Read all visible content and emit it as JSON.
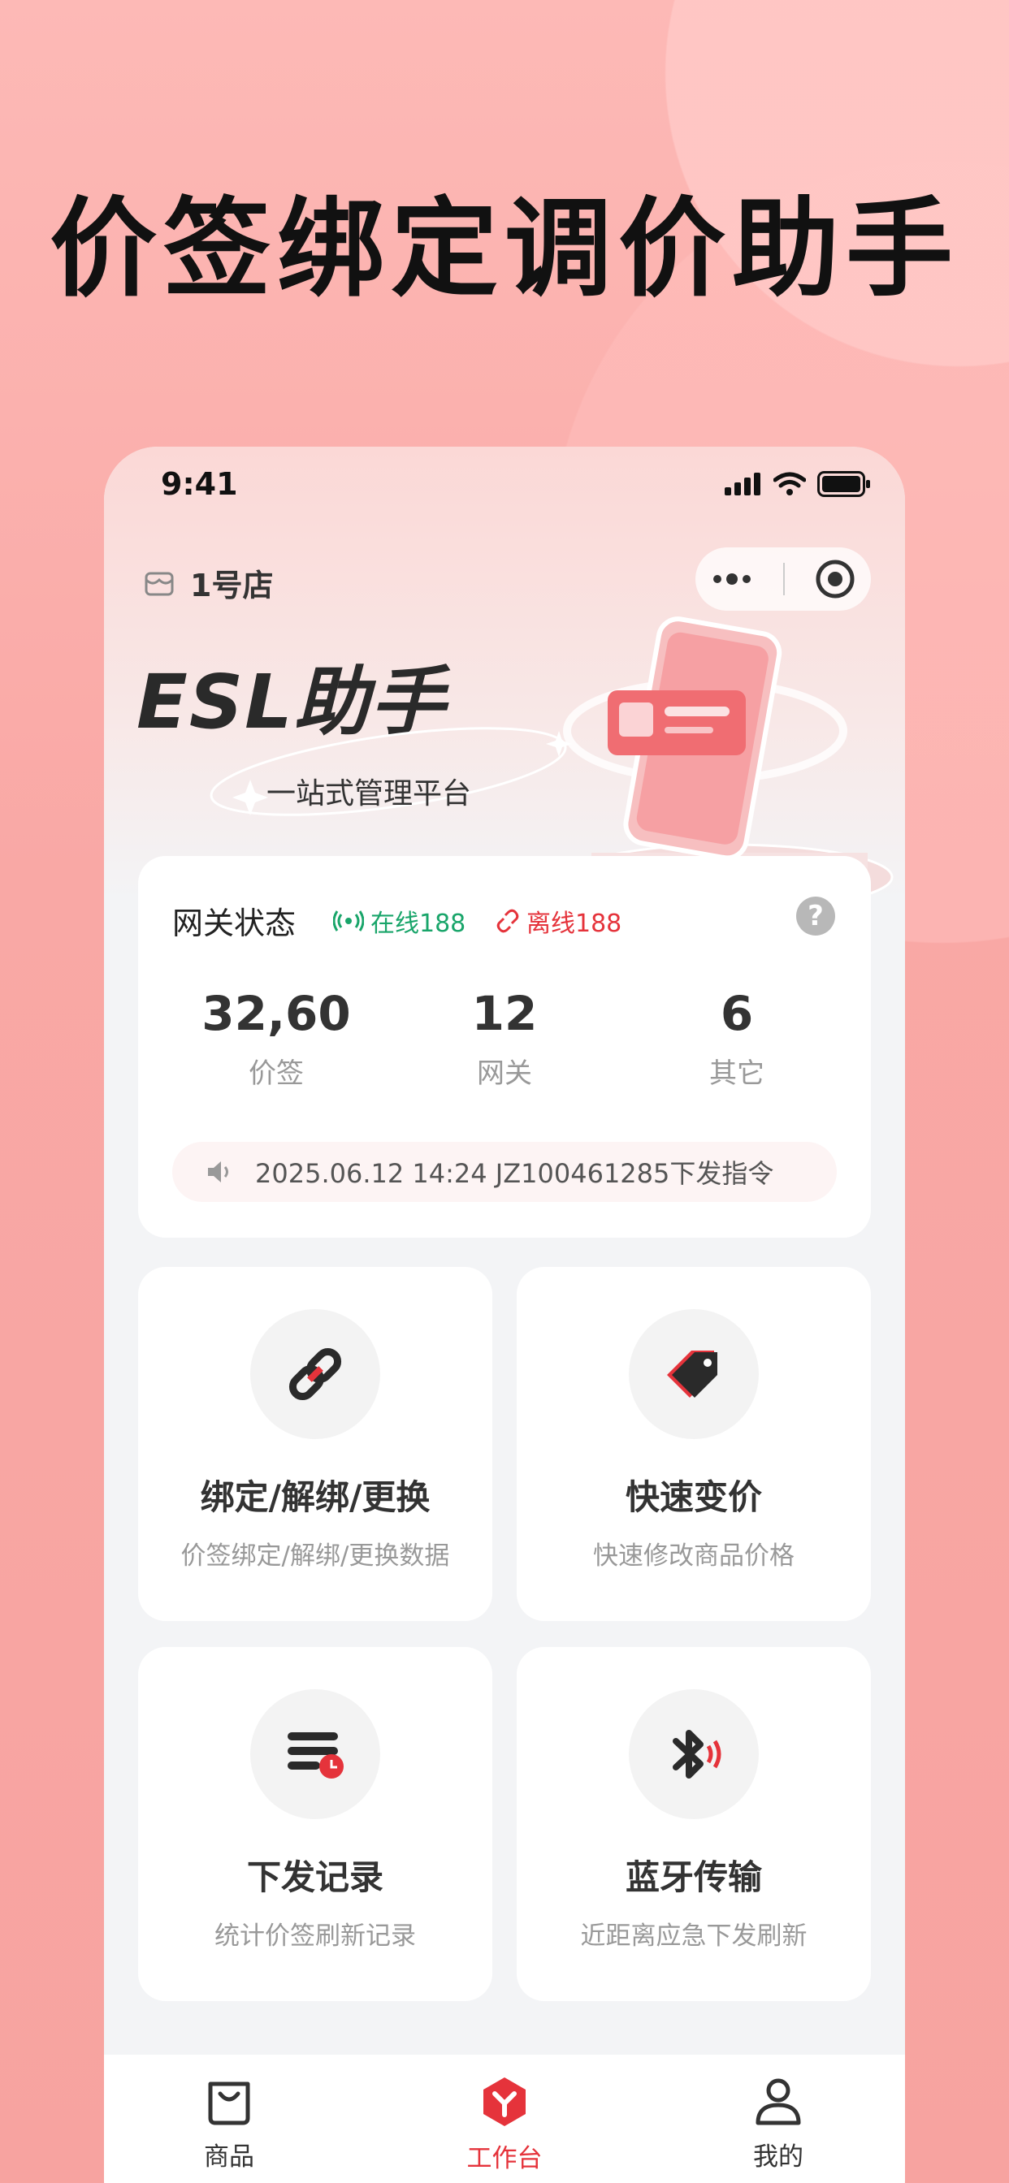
{
  "headline": "价签绑定调价助手",
  "status_bar": {
    "time": "9:41"
  },
  "header": {
    "store_name": "1号店",
    "brand_title": "ESL助手",
    "brand_subtitle": "一站式管理平台"
  },
  "gateway": {
    "title": "网关状态",
    "online_label": "在线188",
    "offline_label": "离线188",
    "stats": [
      {
        "value": "32,60",
        "label": "价签"
      },
      {
        "value": "12",
        "label": "网关"
      },
      {
        "value": "6",
        "label": "其它"
      }
    ],
    "notice": "2025.06.12 14:24   JZ100461285下发指令"
  },
  "functions": [
    {
      "title": "绑定/解绑/更换",
      "desc": "价签绑定/解绑/更换数据",
      "icon": "link-icon"
    },
    {
      "title": "快速变价",
      "desc": "快速修改商品价格",
      "icon": "price-tag-icon"
    },
    {
      "title": "下发记录",
      "desc": "统计价签刷新记录",
      "icon": "record-icon"
    },
    {
      "title": "蓝牙传输",
      "desc": "近距离应急下发刷新",
      "icon": "bluetooth-icon"
    }
  ],
  "tabbar": [
    {
      "label": "商品",
      "icon": "shopping-bag-icon",
      "active": false
    },
    {
      "label": "工作台",
      "icon": "workbench-icon",
      "active": true
    },
    {
      "label": "我的",
      "icon": "user-icon",
      "active": false
    }
  ],
  "colors": {
    "accent": "#e5333b",
    "online": "#19a56a",
    "background": "#f9aaa7"
  }
}
